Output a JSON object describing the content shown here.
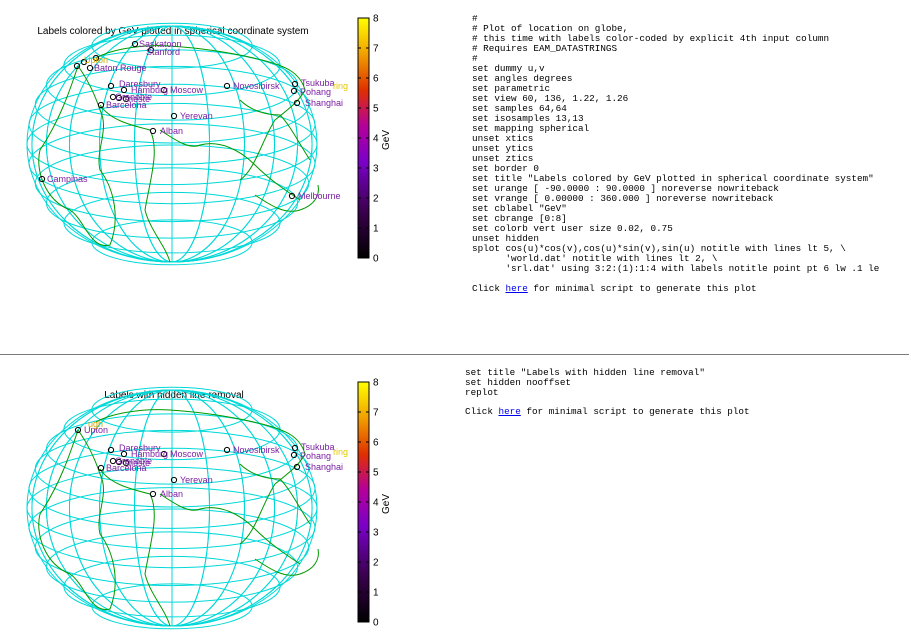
{
  "panels": [
    {
      "title": "Labels colored by GeV plotted in spherical coordinate system",
      "colorbar": {
        "label": "GeV",
        "ticks": [
          "0",
          "1",
          "2",
          "3",
          "4",
          "5",
          "6",
          "7",
          "8"
        ]
      },
      "labels": [
        {
          "text": "Saskatoon",
          "color": "#7b1fa2"
        },
        {
          "text": "Stanford",
          "color": "#7b1fa2"
        },
        {
          "text": "Baton Rouge",
          "color": "#7b1fa2"
        },
        {
          "text": "Campinas",
          "color": "#7b1fa2"
        },
        {
          "text": "Moscow",
          "color": "#7b1fa2"
        },
        {
          "text": "Novosibirsk",
          "color": "#7b1fa2"
        },
        {
          "text": "Tsukuba",
          "color": "#7b1fa2"
        },
        {
          "text": "Pohang",
          "color": "#7b1fa2"
        },
        {
          "text": "Shanghai",
          "color": "#7b1fa2"
        },
        {
          "text": "Yerevan",
          "color": "#7b1fa2"
        },
        {
          "text": "Alban",
          "color": "#7b1fa2"
        },
        {
          "text": "Melbourne",
          "color": "#7b1fa2"
        },
        {
          "text": "Hamburg",
          "color": "#7b1fa2"
        },
        {
          "text": "Daresbury",
          "color": "#7b1fa2"
        },
        {
          "text": "Grenoble",
          "color": "#7b1fa2"
        },
        {
          "text": "Trieste",
          "color": "#7b1fa2"
        },
        {
          "text": "Barcelona",
          "color": "#7b1fa2"
        },
        {
          "text": "Upton",
          "color": "#7b1fa2"
        }
      ],
      "code": [
        "#",
        "# Plot of location on globe,",
        "# this time with labels color-coded by explicit 4th input column",
        "# Requires EAM_DATASTRINGS",
        "#",
        "set dummy u,v",
        "set angles degrees",
        "set parametric",
        "set view 60, 136, 1.22, 1.26",
        "set samples 64,64",
        "set isosamples 13,13",
        "set mapping spherical",
        "unset xtics",
        "unset ytics",
        "unset ztics",
        "set border 0",
        "set title \"Labels colored by GeV plotted in spherical coordinate system\"",
        "set urange [ -90.0000 : 90.0000 ] noreverse nowriteback",
        "set vrange [ 0.00000 : 360.000 ] noreverse nowriteback",
        "set cblabel \"GeV\"",
        "set cbrange [0:8]",
        "set colorb vert user size 0.02, 0.75",
        "unset hidden",
        "splot cos(u)*cos(v),cos(u)*sin(v),sin(u) notitle with lines lt 5, \\",
        "      'world.dat' notitle with lines lt 2, \\",
        "      'srl.dat' using 3:2:(1):1:4 with labels notitle point pt 6 lw .1 le"
      ],
      "click": {
        "pre": "Click ",
        "link": "here",
        "post": " for minimal script to generate this plot"
      }
    },
    {
      "title": "Labels with hidden line removal",
      "colorbar": {
        "label": "GeV",
        "ticks": [
          "0",
          "1",
          "2",
          "3",
          "4",
          "5",
          "6",
          "7",
          "8"
        ]
      },
      "labels": [
        {
          "text": "Upton",
          "color": "#7b1fa2"
        },
        {
          "text": "Moscow",
          "color": "#7b1fa2"
        },
        {
          "text": "Novosibirsk",
          "color": "#7b1fa2"
        },
        {
          "text": "Tsukuba",
          "color": "#7b1fa2"
        },
        {
          "text": "Pohang",
          "color": "#7b1fa2"
        },
        {
          "text": "Shanghai",
          "color": "#7b1fa2"
        },
        {
          "text": "Yerevan",
          "color": "#7b1fa2"
        },
        {
          "text": "Alban",
          "color": "#7b1fa2"
        },
        {
          "text": "Hamburg",
          "color": "#7b1fa2"
        },
        {
          "text": "Daresbury",
          "color": "#7b1fa2"
        },
        {
          "text": "Grenoble",
          "color": "#7b1fa2"
        },
        {
          "text": "Trieste",
          "color": "#7b1fa2"
        },
        {
          "text": "Barcelona",
          "color": "#7b1fa2"
        }
      ],
      "code": [
        "set title \"Labels with hidden line removal\"",
        "set hidden nooffset",
        "replot"
      ],
      "click": {
        "pre": "Click ",
        "link": "here",
        "post": " for minimal script to generate this plot"
      }
    }
  ],
  "colors": {
    "grid": "#00d8d8",
    "land": "#009900",
    "frame": "#000000",
    "divider": "#7a7a7a",
    "link": "#0000ee"
  }
}
